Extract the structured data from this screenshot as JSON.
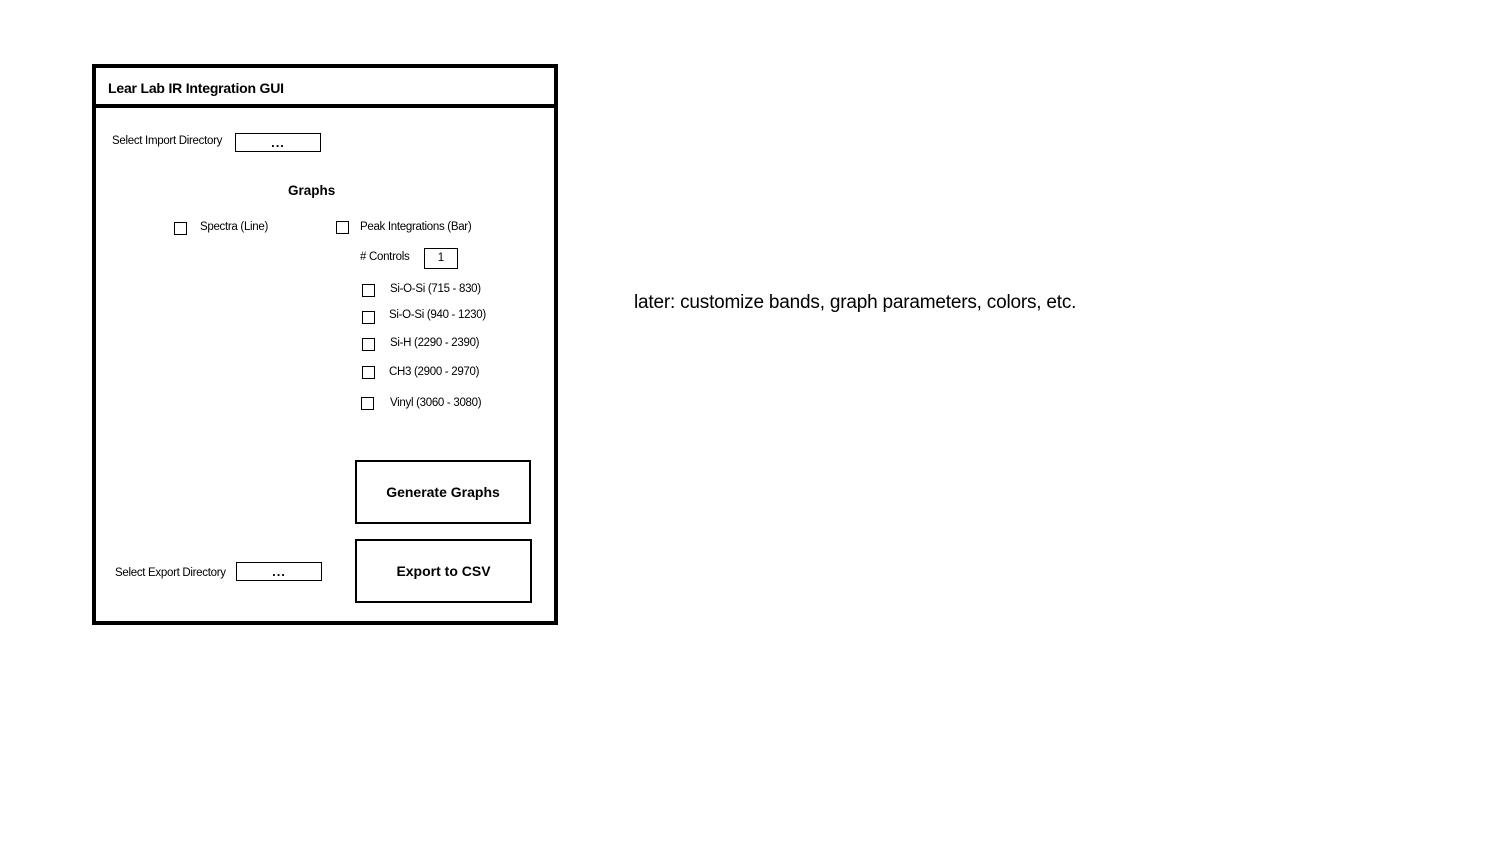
{
  "window": {
    "title": "Lear Lab IR Integration GUI"
  },
  "import": {
    "label": "Select Import Directory",
    "button_label": "..."
  },
  "graphs": {
    "heading": "Graphs",
    "spectra_label": "Spectra (Line)",
    "peak_label": "Peak Integrations (Bar)",
    "controls_label": "# Controls",
    "controls_value": "1",
    "bands": [
      {
        "label": "Si-O-Si (715 - 830)",
        "checked": false
      },
      {
        "label": "Si-O-Si (940 - 1230)",
        "checked": false
      },
      {
        "label": "Si-H (2290 - 2390)",
        "checked": false
      },
      {
        "label": "CH3 (2900 - 2970)",
        "checked": false
      },
      {
        "label": "Vinyl (3060 - 3080)",
        "checked": false
      }
    ]
  },
  "actions": {
    "generate_label": "Generate Graphs",
    "export_label": "Export to CSV"
  },
  "export": {
    "label": "Select Export Directory",
    "button_label": "..."
  },
  "note": "later: customize bands, graph parameters, colors, etc."
}
